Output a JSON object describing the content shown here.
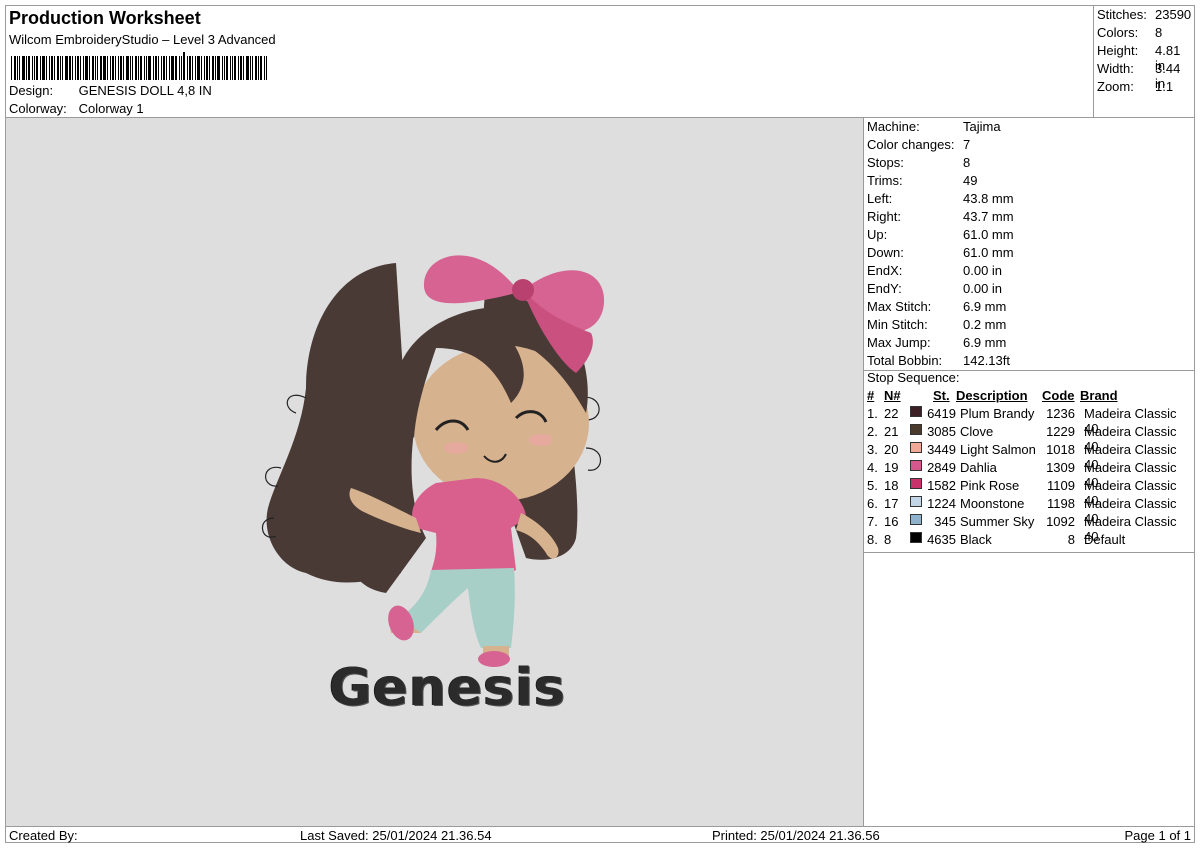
{
  "header": {
    "title": "Production Worksheet",
    "subtitle": "Wilcom EmbroideryStudio – Level 3 Advanced",
    "design_label": "Design:",
    "design_value": "GENESIS DOLL 4,8 IN",
    "colorway_label": "Colorway:",
    "colorway_value": "Colorway 1"
  },
  "stats": [
    {
      "label": "Stitches:",
      "value": "23590"
    },
    {
      "label": "Colors:",
      "value": "8"
    },
    {
      "label": "Height:",
      "value": "4.81 in"
    },
    {
      "label": "Width:",
      "value": "3.44 in"
    },
    {
      "label": "Zoom:",
      "value": "1:1"
    }
  ],
  "preview": {
    "name_text": "Genesis",
    "colors": {
      "background": "#dedede",
      "hair": "#4a3a35",
      "bow": "#d66392",
      "skin": "#d6b28f",
      "shirt": "#d9608d",
      "pants": "#a8cfc7",
      "text": "#2b2b2b"
    }
  },
  "machine_info": [
    {
      "label": "Machine:",
      "value": "Tajima"
    },
    {
      "label": "Color changes:",
      "value": "7"
    },
    {
      "label": "Stops:",
      "value": "8"
    },
    {
      "label": "Trims:",
      "value": "49"
    },
    {
      "label": "Left:",
      "value": "43.8 mm"
    },
    {
      "label": "Right:",
      "value": "43.7 mm"
    },
    {
      "label": "Up:",
      "value": "61.0 mm"
    },
    {
      "label": "Down:",
      "value": "61.0 mm"
    },
    {
      "label": "EndX:",
      "value": "0.00 in"
    },
    {
      "label": "EndY:",
      "value": "0.00 in"
    },
    {
      "label": "Max Stitch:",
      "value": "6.9 mm"
    },
    {
      "label": "Min Stitch:",
      "value": "0.2 mm"
    },
    {
      "label": "Max Jump:",
      "value": "6.9 mm"
    },
    {
      "label": "Total Bobbin:",
      "value": "142.13ft"
    }
  ],
  "stop_sequence": {
    "title": "Stop Sequence:",
    "headers": {
      "num": "#",
      "n": "N#",
      "st": "St.",
      "description": "Description",
      "code": "Code",
      "brand": "Brand"
    },
    "rows": [
      {
        "num": "1.",
        "n": "22",
        "color": "#3b1f25",
        "st": "6419",
        "description": "Plum Brandy",
        "code": "1236",
        "brand": "Madeira Classic 40"
      },
      {
        "num": "2.",
        "n": "21",
        "color": "#4a3a2c",
        "st": "3085",
        "description": "Clove",
        "code": "1229",
        "brand": "Madeira Classic 40"
      },
      {
        "num": "3.",
        "n": "20",
        "color": "#f0a996",
        "st": "3449",
        "description": "Light Salmon",
        "code": "1018",
        "brand": "Madeira Classic 40"
      },
      {
        "num": "4.",
        "n": "19",
        "color": "#d4588e",
        "st": "2849",
        "description": "Dahlia",
        "code": "1309",
        "brand": "Madeira Classic 40"
      },
      {
        "num": "5.",
        "n": "18",
        "color": "#c8336c",
        "st": "1582",
        "description": "Pink Rose",
        "code": "1109",
        "brand": "Madeira Classic 40"
      },
      {
        "num": "6.",
        "n": "17",
        "color": "#c2d6e8",
        "st": "1224",
        "description": "Moonstone",
        "code": "1198",
        "brand": "Madeira Classic 40"
      },
      {
        "num": "7.",
        "n": "16",
        "color": "#8fb2cc",
        "st": "345",
        "description": "Summer Sky",
        "code": "1092",
        "brand": "Madeira Classic 40"
      },
      {
        "num": "8.",
        "n": "8",
        "color": "#000000",
        "st": "4635",
        "description": "Black",
        "code": "8",
        "brand": "Default"
      }
    ]
  },
  "footer": {
    "created_by": "Created By:",
    "last_saved": "Last Saved: 25/01/2024 21.36.54",
    "printed": "Printed: 25/01/2024 21.36.56",
    "page": "Page 1 of 1"
  }
}
